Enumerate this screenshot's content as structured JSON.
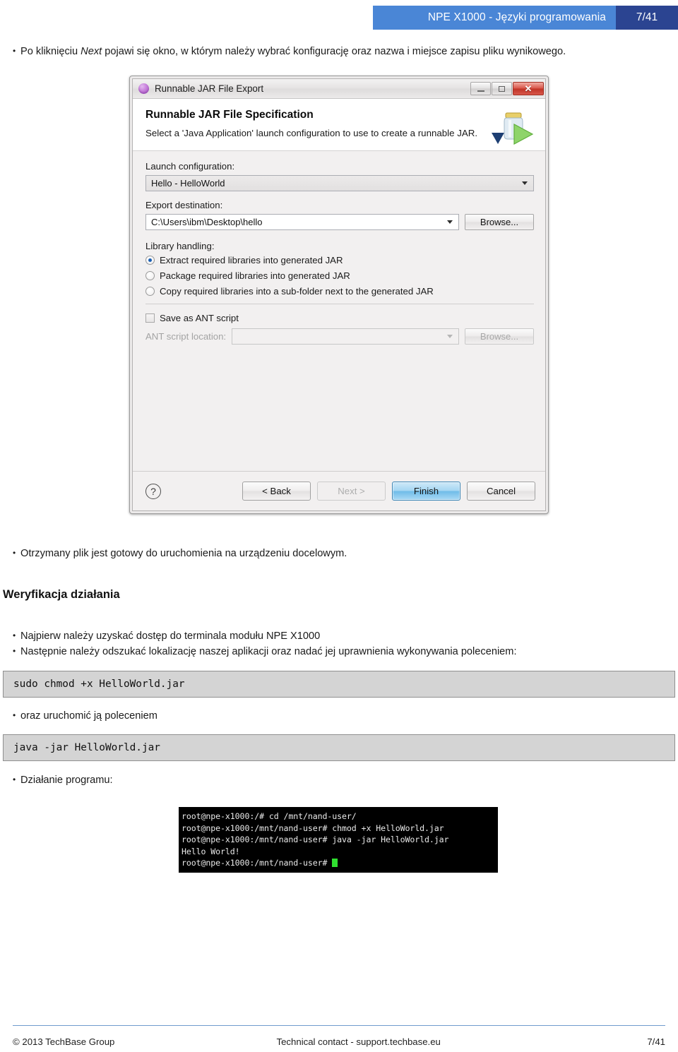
{
  "header": {
    "title": "NPE X1000 - Języki programowania",
    "page": "7/41"
  },
  "intro": {
    "prefix": "Po kliknięciu ",
    "emphasis": "Next",
    "suffix": " pojawi się okno, w którym należy wybrać konfigurację oraz nazwa i miejsce zapisu pliku wynikowego."
  },
  "dialog": {
    "titlebar": {
      "title": "Runnable JAR File Export",
      "icon": "jar-sphere-icon",
      "minimize": "minimize-icon",
      "maximize": "maximize-icon",
      "close": "✕"
    },
    "heading": "Runnable JAR File Specification",
    "subheading": "Select a 'Java Application' launch configuration to use to create a runnable JAR.",
    "launch_configuration": {
      "label": "Launch configuration:",
      "value": "Hello - HelloWorld"
    },
    "export_destination": {
      "label": "Export destination:",
      "value": "C:\\Users\\ibm\\Desktop\\hello",
      "browse": "Browse..."
    },
    "library_handling": {
      "label": "Library handling:",
      "options": [
        {
          "label": "Extract required libraries into generated JAR",
          "selected": true
        },
        {
          "label": "Package required libraries into generated JAR",
          "selected": false
        },
        {
          "label": "Copy required libraries into a sub-folder next to the generated JAR",
          "selected": false
        }
      ]
    },
    "ant": {
      "checkbox_label": "Save as ANT script",
      "checked": false,
      "location_label": "ANT script location:",
      "location_value": "",
      "browse": "Browse..."
    },
    "buttons": {
      "help": "?",
      "back": "< Back",
      "next": "Next >",
      "finish": "Finish",
      "cancel": "Cancel"
    }
  },
  "body": {
    "ready_line": "Otrzymany plik jest gotowy do uruchomienia na urządzeniu docelowym.",
    "section_heading": "Weryfikacja działania",
    "step1": "Najpierw należy uzyskać dostęp do terminala modułu NPE X1000",
    "step2": "Następnie należy odszukać lokalizację naszej aplikacji oraz nadać jej uprawnienia wykonywania poleceniem:",
    "code1": "sudo chmod +x HelloWorld.jar",
    "step3": "oraz uruchomić ją poleceniem",
    "code2": "java -jar HelloWorld.jar",
    "step4": "Działanie programu:"
  },
  "terminal": {
    "line1": "root@npe-x1000:/# cd /mnt/nand-user/",
    "line2": "root@npe-x1000:/mnt/nand-user# chmod +x HelloWorld.jar",
    "line3": "root@npe-x1000:/mnt/nand-user# java -jar HelloWorld.jar",
    "line4": "Hello World!",
    "line5": "root@npe-x1000:/mnt/nand-user# "
  },
  "footer": {
    "left": "© 2013 TechBase Group",
    "middle": "Technical contact - support.techbase.eu",
    "right": "7/41"
  },
  "colors": {
    "header_blue": "#4a86d6",
    "header_navy": "#2b4491",
    "footer_rule": "#6f9ccd",
    "code_bg": "#d4d4d4",
    "terminal_bg": "#000000",
    "cursor_green": "#30e030",
    "default_button_blue": "#6fbce8"
  }
}
